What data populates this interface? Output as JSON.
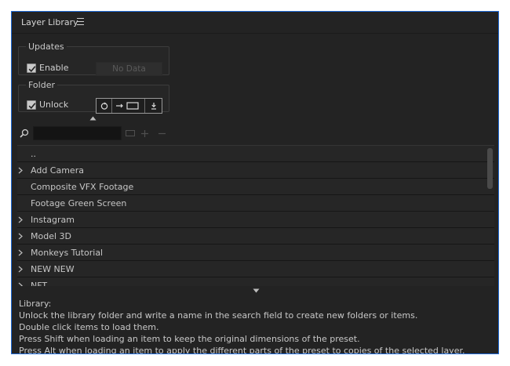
{
  "panel": {
    "title": "Layer Library",
    "menu_icon": "hamburger-menu-icon"
  },
  "updates": {
    "legend": "Updates",
    "enable_label": "Enable",
    "enable_checked": true,
    "status_button": "No Data"
  },
  "folder": {
    "legend": "Folder",
    "unlock_label": "Unlock",
    "unlock_checked": true,
    "tools": [
      "refresh-icon",
      "link-composition-icon",
      "download-icon"
    ]
  },
  "search": {
    "value": "",
    "placeholder": ""
  },
  "list": {
    "items": [
      {
        "label": "..",
        "expandable": false
      },
      {
        "label": "Add Camera",
        "expandable": true
      },
      {
        "label": "Composite VFX Footage",
        "expandable": false
      },
      {
        "label": "Footage Green Screen",
        "expandable": false
      },
      {
        "label": "Instagram",
        "expandable": true
      },
      {
        "label": "Model 3D",
        "expandable": true
      },
      {
        "label": "Monkeys Tutorial",
        "expandable": true
      },
      {
        "label": "NEW NEW",
        "expandable": true
      },
      {
        "label": "NFT",
        "expandable": true
      }
    ]
  },
  "help": {
    "lines": [
      "Library:",
      "Unlock the library folder and write a name in the search field to create new folders or items.",
      "Double click items to load them.",
      "Press Shift when loading an item to keep the original dimensions of the preset.",
      "Press Alt when loading an item to apply the different parts of the preset to copies of the selected layer."
    ]
  },
  "colors": {
    "panel_bg": "#232323",
    "focus_border": "#1f6ad6",
    "list_row_bg": "#262626",
    "text": "#c8c8c8"
  }
}
